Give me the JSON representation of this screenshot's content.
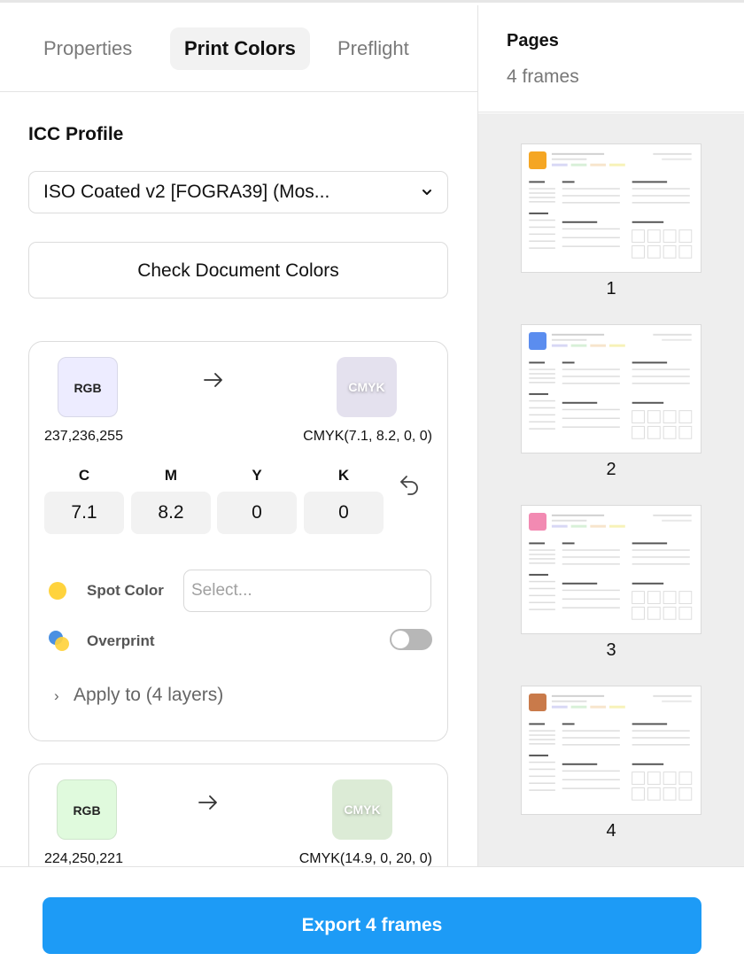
{
  "tabs": [
    {
      "label": "Properties",
      "active": false
    },
    {
      "label": "Print Colors",
      "active": true
    },
    {
      "label": "Preflight",
      "active": false
    }
  ],
  "icc": {
    "title": "ICC Profile",
    "selected": "ISO Coated v2 [FOGRA39] (Mos...",
    "check_button": "Check Document Colors"
  },
  "colors": [
    {
      "rgb_label": "RGB",
      "cmyk_label": "CMYK",
      "rgb_value": "237,236,255",
      "cmyk_value": "CMYK(7.1, 8.2, 0, 0)",
      "rgb_swatch": "#edecff",
      "cmyk_swatch": "#e4e1ee",
      "channels": [
        {
          "label": "C",
          "value": "7.1"
        },
        {
          "label": "M",
          "value": "8.2"
        },
        {
          "label": "Y",
          "value": "0"
        },
        {
          "label": "K",
          "value": "0"
        }
      ],
      "spot_label": "Spot Color",
      "spot_placeholder": "Select...",
      "overprint_label": "Overprint",
      "overprint_on": false,
      "apply_label": "Apply to (4 layers)"
    },
    {
      "rgb_label": "RGB",
      "cmyk_label": "CMYK",
      "rgb_value": "224,250,221",
      "cmyk_value": "CMYK(14.9, 0, 20, 0)",
      "rgb_swatch": "#e0fadd",
      "cmyk_swatch": "#dcebd6"
    }
  ],
  "pages": {
    "title": "Pages",
    "subtitle": "4 frames",
    "items": [
      {
        "number": "1",
        "avatar": "#f5a623"
      },
      {
        "number": "2",
        "avatar": "#5b8def"
      },
      {
        "number": "3",
        "avatar": "#f28ab2"
      },
      {
        "number": "4",
        "avatar": "#c97a4a"
      }
    ]
  },
  "footer": {
    "export_label": "Export 4 frames"
  },
  "theme": {
    "accent": "#1d9bf6",
    "spot_yellow": "#ffd33d",
    "overprint_blue": "#4a90e2"
  }
}
